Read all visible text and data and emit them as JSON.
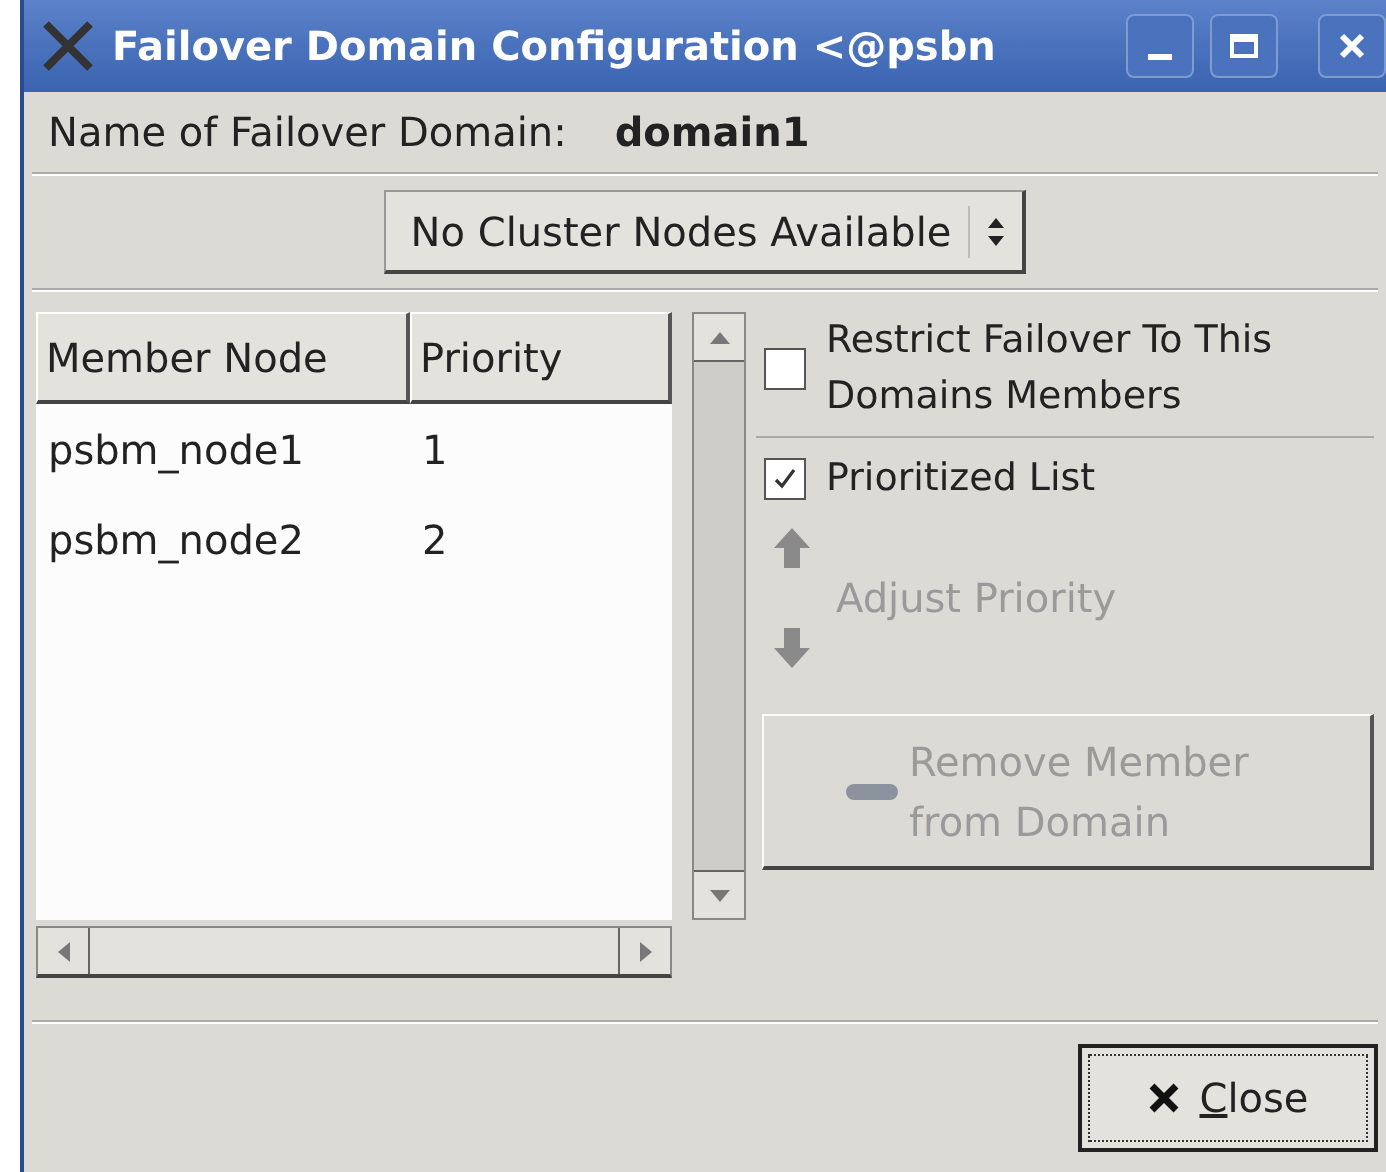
{
  "window": {
    "title": "Failover Domain Configuration <@psbn"
  },
  "domain_name": {
    "label": "Name of Failover Domain:",
    "value": "domain1"
  },
  "node_dropdown": {
    "value": "No Cluster Nodes Available"
  },
  "table": {
    "columns": [
      "Member Node",
      "Priority"
    ],
    "rows": [
      {
        "node": "psbm_node1",
        "priority": "1"
      },
      {
        "node": "psbm_node2",
        "priority": "2"
      }
    ]
  },
  "options": [
    {
      "label": "Restrict Failover To This Domains Members",
      "checked": false
    },
    {
      "label": "Prioritized List",
      "checked": true
    }
  ],
  "adjust_priority": {
    "label": "Adjust Priority",
    "disabled": true
  },
  "remove_button": {
    "label": "Remove Member from Domain",
    "disabled": true
  },
  "close_button": {
    "label": "Close"
  }
}
